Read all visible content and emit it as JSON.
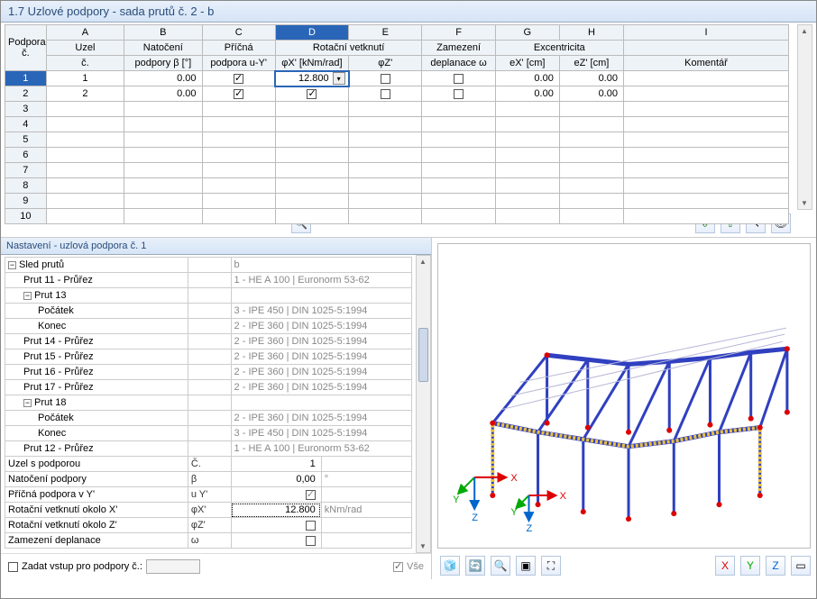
{
  "title": "1.7 Uzlové podpory - sada prutů č. 2 - b",
  "columns": {
    "letters": [
      "A",
      "B",
      "C",
      "D",
      "E",
      "F",
      "G",
      "H",
      "I"
    ],
    "row1": {
      "rowhdr": "Podpora",
      "a": "Uzel",
      "b": "Natočení",
      "c": "Příčná",
      "de": "Rotační vetknutí",
      "f": "Zamezení",
      "gh": "Excentricita",
      "i": ""
    },
    "row2": {
      "rowhdr": "č.",
      "a": "č.",
      "b": "podpory β [°]",
      "c": "podpora u-Y'",
      "d": "φX' [kNm/rad]",
      "e": "φZ'",
      "f": "deplanace ω",
      "g": "eX' [cm]",
      "h": "eZ' [cm]",
      "i": "Komentář"
    }
  },
  "rows": [
    {
      "n": "1",
      "uzel": "1",
      "beta": "0.00",
      "pricna": true,
      "phix_val": "12.800",
      "phix_dd": true,
      "phiz": false,
      "omega": false,
      "ex": "0.00",
      "ez": "0.00"
    },
    {
      "n": "2",
      "uzel": "2",
      "beta": "0.00",
      "pricna": true,
      "phix_chk": true,
      "phiz": false,
      "omega": false,
      "ex": "0.00",
      "ez": "0.00"
    }
  ],
  "empty_rows": [
    "3",
    "4",
    "5",
    "6",
    "7",
    "8",
    "9",
    "10"
  ],
  "settings_title": "Nastavení - uzlová podpora č. 1",
  "tree": [
    {
      "type": "group",
      "toggle": "-",
      "label": "Sled prutů",
      "val": "b"
    },
    {
      "type": "row",
      "indent": 1,
      "label": "Prut 11 - Průřez",
      "val": "1 - HE A 100 | Euronorm 53-62"
    },
    {
      "type": "group",
      "toggle": "-",
      "indent": 1,
      "label": "Prut 13"
    },
    {
      "type": "row",
      "indent": 2,
      "label": "Počátek",
      "val": "3 - IPE 450 | DIN 1025-5:1994"
    },
    {
      "type": "row",
      "indent": 2,
      "label": "Konec",
      "val": "2 - IPE 360 | DIN 1025-5:1994"
    },
    {
      "type": "row",
      "indent": 1,
      "label": "Prut 14 - Průřez",
      "val": "2 - IPE 360 | DIN 1025-5:1994"
    },
    {
      "type": "row",
      "indent": 1,
      "label": "Prut 15 - Průřez",
      "val": "2 - IPE 360 | DIN 1025-5:1994"
    },
    {
      "type": "row",
      "indent": 1,
      "label": "Prut 16 - Průřez",
      "val": "2 - IPE 360 | DIN 1025-5:1994"
    },
    {
      "type": "row",
      "indent": 1,
      "label": "Prut 17 - Průřez",
      "val": "2 - IPE 360 | DIN 1025-5:1994"
    },
    {
      "type": "group",
      "toggle": "-",
      "indent": 1,
      "label": "Prut 18"
    },
    {
      "type": "row",
      "indent": 2,
      "label": "Počátek",
      "val": "2 - IPE 360 | DIN 1025-5:1994"
    },
    {
      "type": "row",
      "indent": 2,
      "label": "Konec",
      "val": "3 - IPE 450 | DIN 1025-5:1994"
    },
    {
      "type": "row",
      "indent": 1,
      "label": "Prut 12 - Průřez",
      "val": "1 - HE A 100 | Euronorm 53-62"
    },
    {
      "type": "param",
      "label": "Uzel s podporou",
      "sym": "Č.",
      "val": "1",
      "dark": true
    },
    {
      "type": "param",
      "label": "Natočení podpory",
      "sym": "β",
      "val": "0,00",
      "unit": "°",
      "dark": true
    },
    {
      "type": "param",
      "label": "Příčná podpora v Y'",
      "sym": "u Y'",
      "chk": true
    },
    {
      "type": "param",
      "label": "Rotační vetknutí okolo X'",
      "sym": "φX'",
      "val": "12.800",
      "unit": "kNm/rad",
      "dark": true,
      "dotted": true
    },
    {
      "type": "param",
      "label": "Rotační vetknutí okolo Z'",
      "sym": "φZ'",
      "chk": false
    },
    {
      "type": "param",
      "label": "Zamezení deplanace",
      "sym": "ω",
      "chk": false
    }
  ],
  "bottom": {
    "checkbox_label": "Zadat vstup pro podpory č.:",
    "vse": "Vše"
  },
  "axes": {
    "x": "X",
    "y": "Y",
    "z": "Z"
  },
  "icons": {
    "filter": "🔍",
    "excel_in": "⇩",
    "excel_out": "⇧",
    "pick": "↖",
    "eye": "👁",
    "r1": "🧊",
    "r2": "🔄",
    "r3": "🔍",
    "r4": "▣",
    "r5": "⛶",
    "v1": "X",
    "v2": "Y",
    "v3": "Z",
    "v4": "▭"
  }
}
